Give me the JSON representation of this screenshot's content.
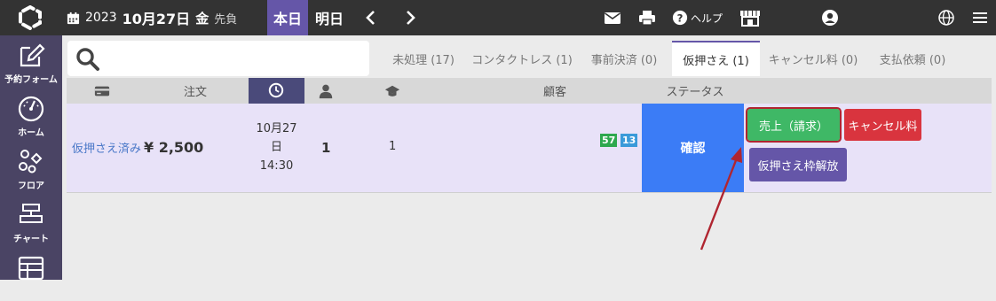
{
  "header": {
    "year": "2023",
    "month_day": "10月27日",
    "weekday": "金",
    "rokuyo": "先負",
    "today_label": "本日",
    "tomorrow_label": "明日",
    "help_label": "ヘルプ"
  },
  "sidebar": {
    "items": [
      {
        "label": "予約フォーム",
        "icon": "pencil-square-icon"
      },
      {
        "label": "ホーム",
        "icon": "gauge-icon"
      },
      {
        "label": "フロア",
        "icon": "shapes-icon"
      },
      {
        "label": "チャート",
        "icon": "chart-bars-icon"
      },
      {
        "label": "",
        "icon": "table-grid-icon"
      }
    ]
  },
  "search": {
    "placeholder": "",
    "value": ""
  },
  "tabs": [
    {
      "label": "未処理 (17)"
    },
    {
      "label": "コンタクトレス (1)"
    },
    {
      "label": "事前決済 (0)"
    },
    {
      "label": "仮押さえ (1)",
      "active": true
    },
    {
      "label": "キャンセル料 (0)"
    },
    {
      "label": "支払依頼 (0)"
    }
  ],
  "table": {
    "headers": {
      "order": "注文",
      "customer": "顧客",
      "status": "ステータス"
    },
    "row": {
      "status_link": "仮押さえ済み",
      "price": "¥ 2,500",
      "date_line1": "10月27",
      "date_line2": "日",
      "time": "14:30",
      "guests": "1",
      "seats": "1",
      "badge_green": "57",
      "badge_blue": "13",
      "confirm_label": "確認",
      "sales_button": "売上（請求）",
      "cancel_fee_button": "キャンセル料",
      "release_button": "仮押さえ枠解放"
    }
  },
  "colors": {
    "topbar": "#333333",
    "sidebar": "#4a4464",
    "accent": "#6556a8",
    "confirm": "#3b7cf6",
    "green": "#3fb866",
    "red": "#d9343e",
    "row_bg": "#e8e2f8",
    "annotation_arrow": "#b02530"
  }
}
